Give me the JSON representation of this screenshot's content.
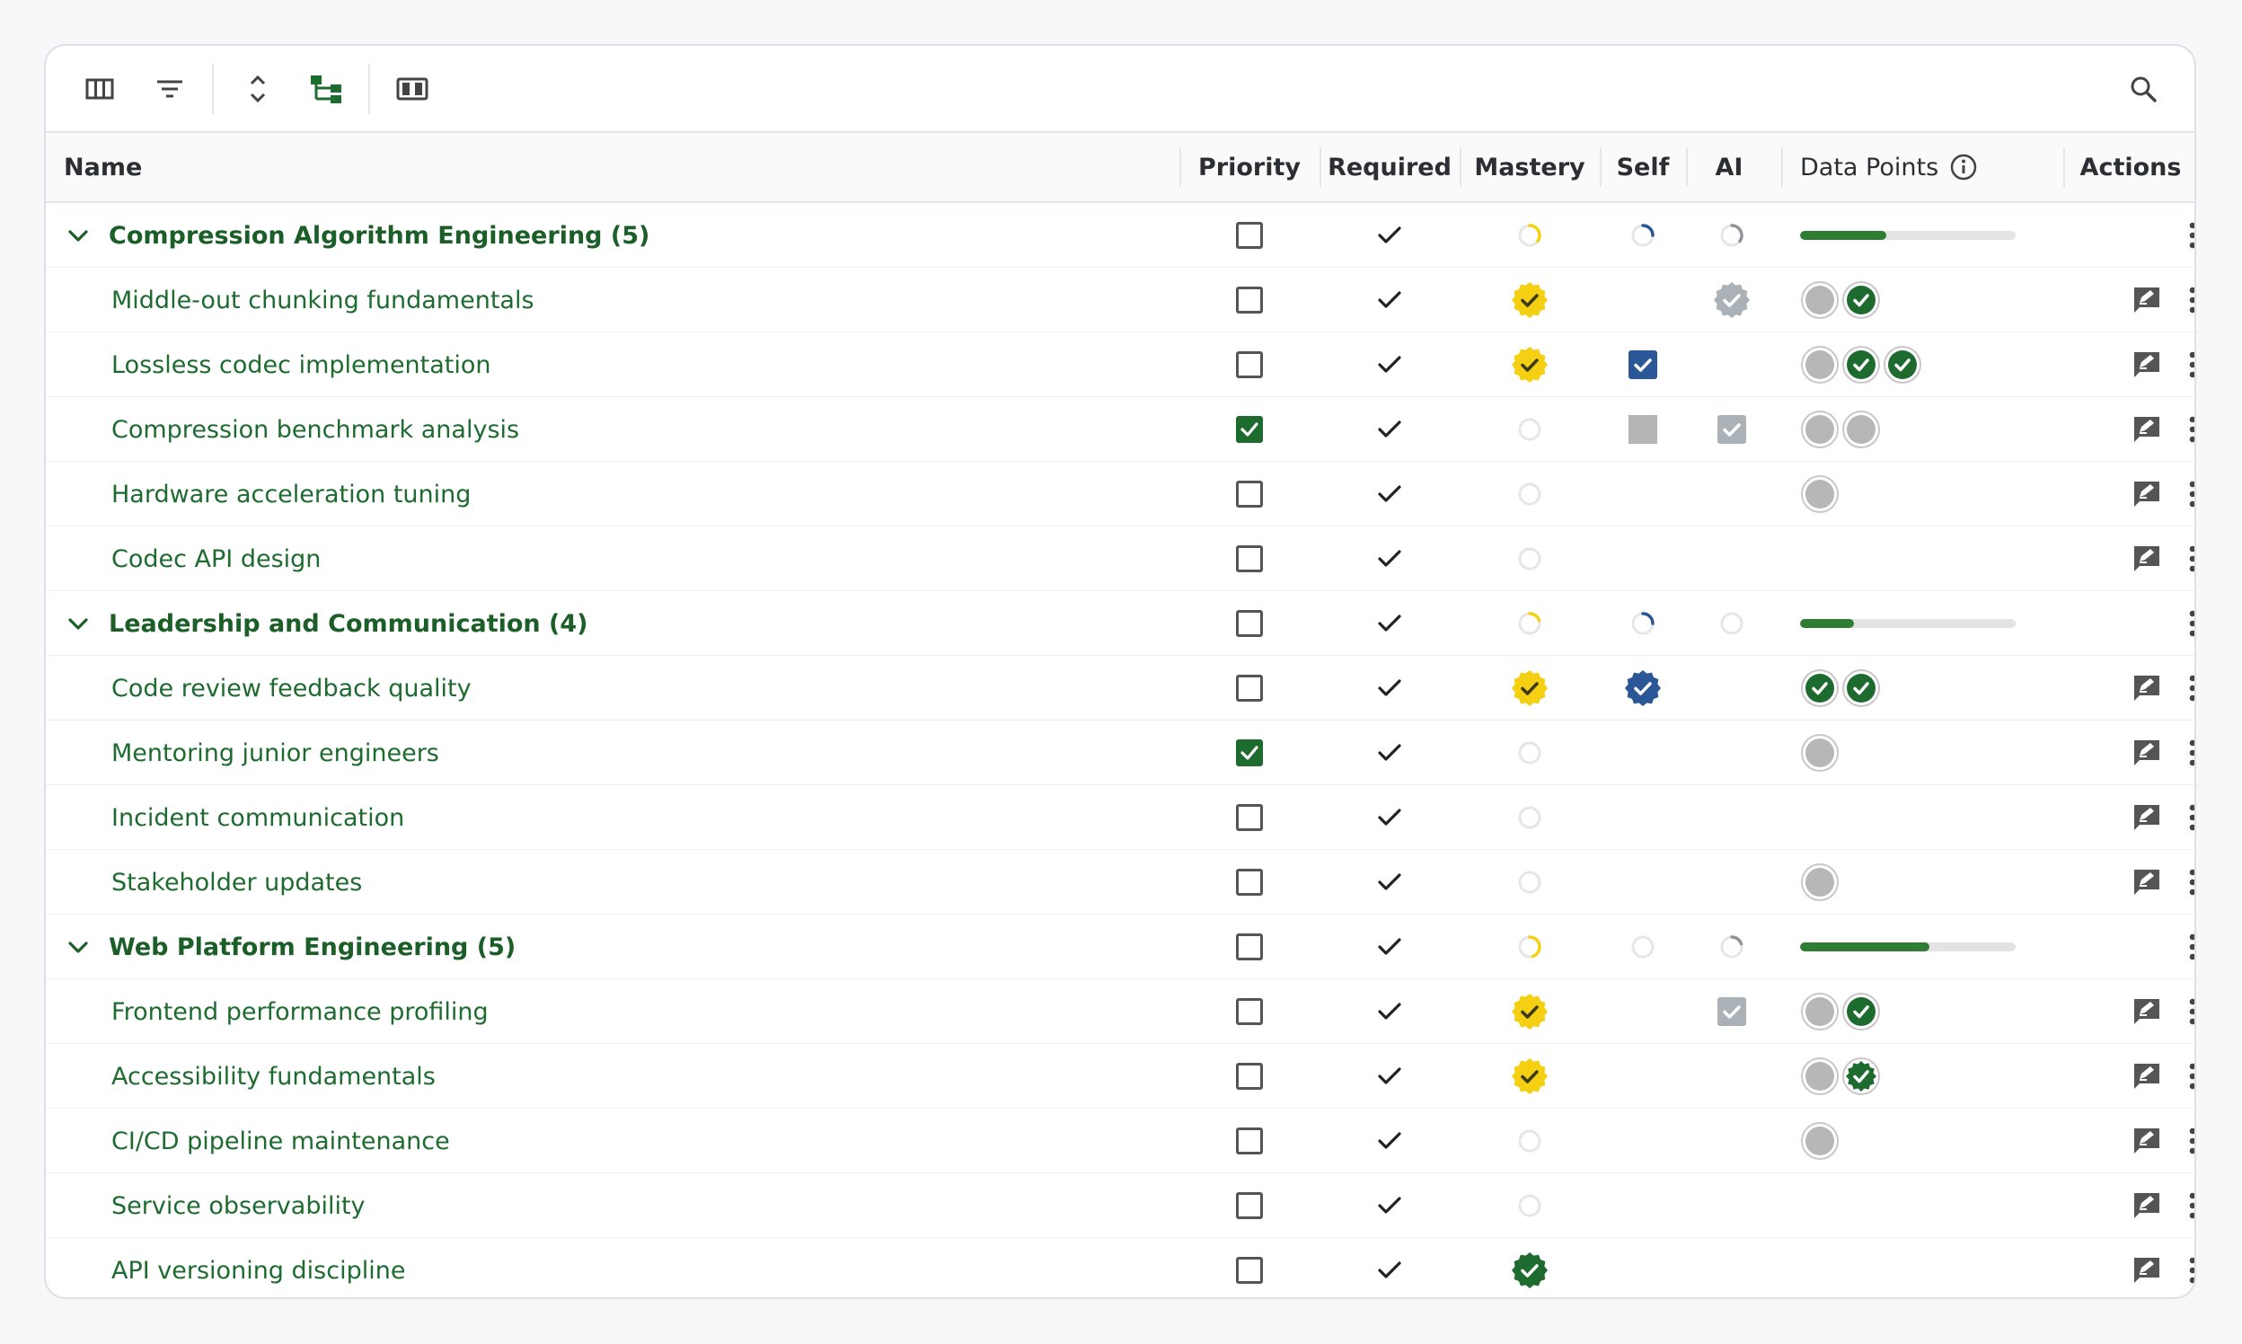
{
  "colors": {
    "green": "#1e6b30",
    "gold": "#f5cf12",
    "blue": "#2b5797",
    "gray": "#b5b5b5",
    "silver": "#aab2b8"
  },
  "toolbar": {
    "icons": [
      "columns-icon",
      "filter-icon",
      "expand-collapse-icon",
      "tree-view-icon",
      "split-view-icon",
      "search-icon"
    ]
  },
  "columns": {
    "name": "Name",
    "priority": "Priority",
    "required": "Required",
    "mastery": "Mastery",
    "self": "Self",
    "ai": "AI",
    "data_points": "Data Points",
    "actions": "Actions"
  },
  "rows": [
    {
      "type": "group",
      "name": "Compression Algorithm Engineering (5)",
      "priority": false,
      "required": true,
      "mastery": "ring-gold",
      "mastery_level": 0.35,
      "self": "ring-blue",
      "self_level": 0.25,
      "ai": "ring-gray",
      "ai_level": 0.35,
      "progress": 0.4
    },
    {
      "type": "item",
      "name": "Middle-out chunking fundamentals",
      "priority": false,
      "required": true,
      "mastery": "badge-gold",
      "self": "",
      "ai": "badge-silver",
      "dp": [
        "gray",
        "green"
      ]
    },
    {
      "type": "item",
      "name": "Lossless codec implementation",
      "priority": false,
      "required": true,
      "mastery": "badge-gold",
      "self": "check-blue",
      "ai": "",
      "dp": [
        "gray",
        "green",
        "green"
      ]
    },
    {
      "type": "item",
      "name": "Compression benchmark analysis",
      "priority": true,
      "required": true,
      "mastery": "ring-empty",
      "self": "square-gray",
      "ai": "check-silver",
      "dp": [
        "gray",
        "gray"
      ]
    },
    {
      "type": "item",
      "name": "Hardware acceleration tuning",
      "priority": false,
      "required": true,
      "mastery": "ring-empty",
      "self": "",
      "ai": "",
      "dp": [
        "gray"
      ]
    },
    {
      "type": "item",
      "name": "Codec API design",
      "priority": false,
      "required": true,
      "mastery": "ring-empty",
      "self": "",
      "ai": "",
      "dp": []
    },
    {
      "type": "group",
      "name": "Leadership and Communication (4)",
      "priority": false,
      "required": true,
      "mastery": "ring-gold",
      "mastery_level": 0.2,
      "self": "ring-blue",
      "self_level": 0.25,
      "ai": "ring-empty",
      "progress": 0.25
    },
    {
      "type": "item",
      "name": "Code review feedback quality",
      "priority": false,
      "required": true,
      "mastery": "badge-gold",
      "self": "badge-blue",
      "ai": "",
      "dp": [
        "green",
        "green"
      ]
    },
    {
      "type": "item",
      "name": "Mentoring junior engineers",
      "priority": true,
      "required": true,
      "mastery": "ring-empty",
      "self": "",
      "ai": "",
      "dp": [
        "gray"
      ]
    },
    {
      "type": "item",
      "name": "Incident communication",
      "priority": false,
      "required": true,
      "mastery": "ring-empty",
      "self": "",
      "ai": "",
      "dp": []
    },
    {
      "type": "item",
      "name": "Stakeholder updates",
      "priority": false,
      "required": true,
      "mastery": "ring-empty",
      "self": "",
      "ai": "",
      "dp": [
        "gray"
      ]
    },
    {
      "type": "group",
      "name": "Web Platform Engineering (5)",
      "priority": false,
      "required": true,
      "mastery": "ring-gold",
      "mastery_level": 0.45,
      "self": "ring-empty",
      "ai": "ring-gray",
      "ai_level": 0.2,
      "progress": 0.6
    },
    {
      "type": "item",
      "name": "Frontend performance profiling",
      "priority": false,
      "required": true,
      "mastery": "badge-gold",
      "self": "",
      "ai": "check-silver",
      "dp": [
        "gray",
        "green"
      ]
    },
    {
      "type": "item",
      "name": "Accessibility fundamentals",
      "priority": false,
      "required": true,
      "mastery": "badge-gold",
      "self": "",
      "ai": "",
      "dp": [
        "gray",
        "green-badge"
      ]
    },
    {
      "type": "item",
      "name": "CI/CD pipeline maintenance",
      "priority": false,
      "required": true,
      "mastery": "ring-empty",
      "self": "",
      "ai": "",
      "dp": [
        "gray"
      ]
    },
    {
      "type": "item",
      "name": "Service observability",
      "priority": false,
      "required": true,
      "mastery": "ring-empty",
      "self": "",
      "ai": "",
      "dp": []
    },
    {
      "type": "item",
      "name": "API versioning discipline",
      "priority": false,
      "required": true,
      "mastery": "badge-green",
      "self": "",
      "ai": "",
      "dp": []
    }
  ]
}
